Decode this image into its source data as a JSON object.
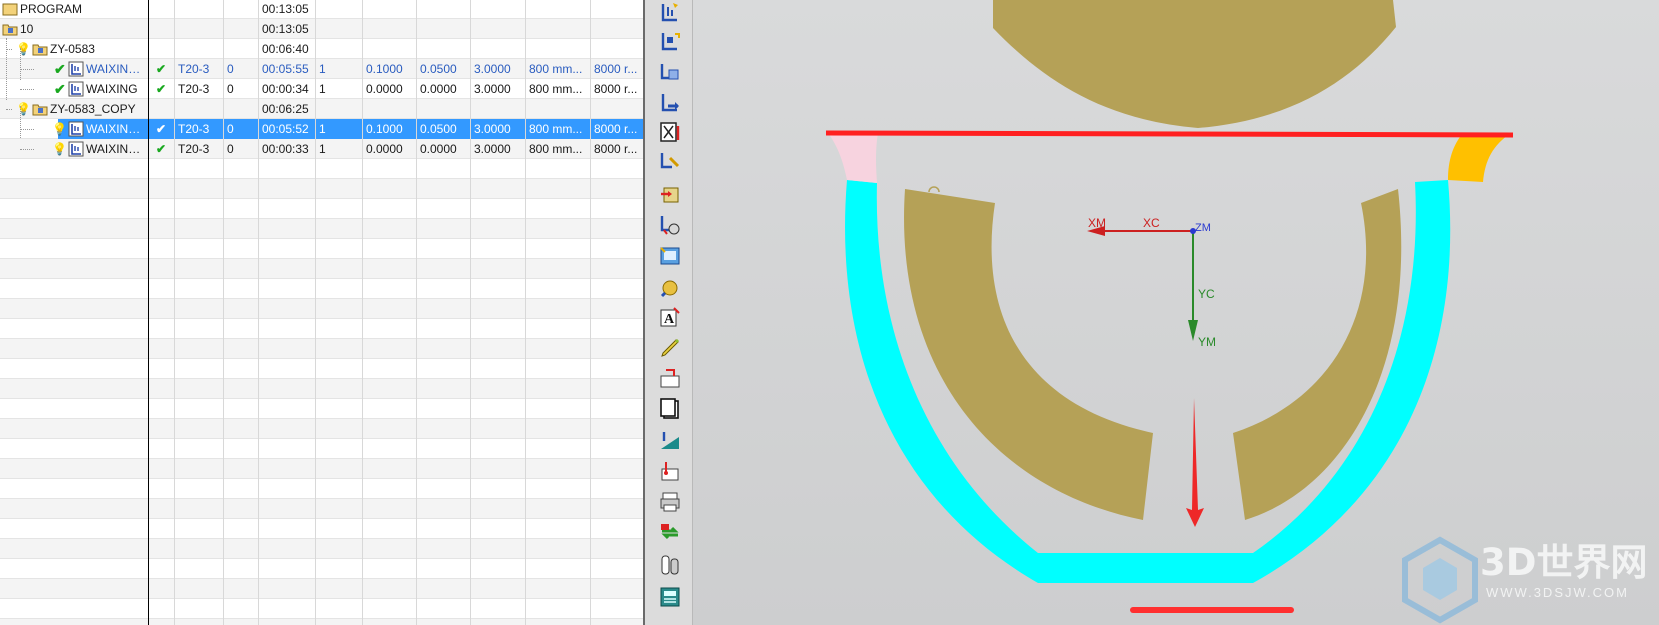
{
  "navigator": {
    "rows": [
      {
        "name": "PROGRAM",
        "time": "00:13:05",
        "level": 0,
        "kind": "program"
      },
      {
        "name": "10",
        "time": "00:13:05",
        "level": 0,
        "kind": "group"
      },
      {
        "name": "ZY-0583",
        "time": "00:06:40",
        "level": 1,
        "kind": "group-warn"
      },
      {
        "name": "WAIXING_C...",
        "check": "✔",
        "tool": "T20-3",
        "n": "0",
        "time": "00:05:55",
        "a": "1",
        "b": "0.1000",
        "c": "0.0500",
        "d": "3.0000",
        "e": "800 mm...",
        "f": "8000 r...",
        "level": 2,
        "kind": "op-ok",
        "blue": true
      },
      {
        "name": "WAIXING",
        "check": "✔",
        "tool": "T20-3",
        "n": "0",
        "time": "00:00:34",
        "a": "1",
        "b": "0.0000",
        "c": "0.0000",
        "d": "3.0000",
        "e": "800 mm...",
        "f": "8000 r...",
        "level": 2,
        "kind": "op-ok"
      },
      {
        "name": "ZY-0583_COPY",
        "time": "00:06:25",
        "level": 1,
        "kind": "group-warn"
      },
      {
        "name": "WAIXING_C...",
        "check": "✔",
        "tool": "T20-3",
        "n": "0",
        "time": "00:05:52",
        "a": "1",
        "b": "0.1000",
        "c": "0.0500",
        "d": "3.0000",
        "e": "800 mm...",
        "f": "8000 r...",
        "level": 2,
        "kind": "op-warn",
        "selected": true
      },
      {
        "name": "WAIXING_C...",
        "check": "✔",
        "tool": "T20-3",
        "n": "0",
        "time": "00:00:33",
        "a": "1",
        "b": "0.0000",
        "c": "0.0000",
        "d": "3.0000",
        "e": "800 mm...",
        "f": "8000 r...",
        "level": 2,
        "kind": "op-warn"
      }
    ],
    "empty_rows": 24,
    "colors": {
      "selection": "#3399ff",
      "blue_text": "#2a5cbf",
      "check": "#1aa820"
    }
  },
  "toolbar": {
    "buttons": [
      "create-operation-icon",
      "create-program-icon",
      "create-geometry-icon",
      "create-tool-icon",
      "generate-toolpath-icon",
      "edit-method-icon",
      "replay-toolpath-icon",
      "verify-toolpath-icon",
      "simulate-machine-icon",
      "machine-tool-icon",
      "text-annotation-icon",
      "pencil-icon",
      "postprocess-icon",
      "shop-docs-icon",
      "feed-rate-icon",
      "output-clsf-icon",
      "print-icon",
      "refresh-icon",
      "object-list-icon",
      "calculator-icon"
    ]
  },
  "viewport": {
    "axes": {
      "xm": "XM",
      "xc": "XC",
      "zm": "ZM",
      "yc": "YC",
      "ym": "YM"
    },
    "colors": {
      "part": "#b5a157",
      "blank": "#00ffff",
      "line": "#ff2020",
      "pink": "#f7d3df",
      "orange": "#ffc000",
      "axis_x": "#cc2020",
      "axis_y": "#2a8a2a",
      "axis_z": "#2a3ad0"
    }
  },
  "watermark": {
    "brand": "3D世界网",
    "url": "WWW.3DSJW.COM"
  }
}
